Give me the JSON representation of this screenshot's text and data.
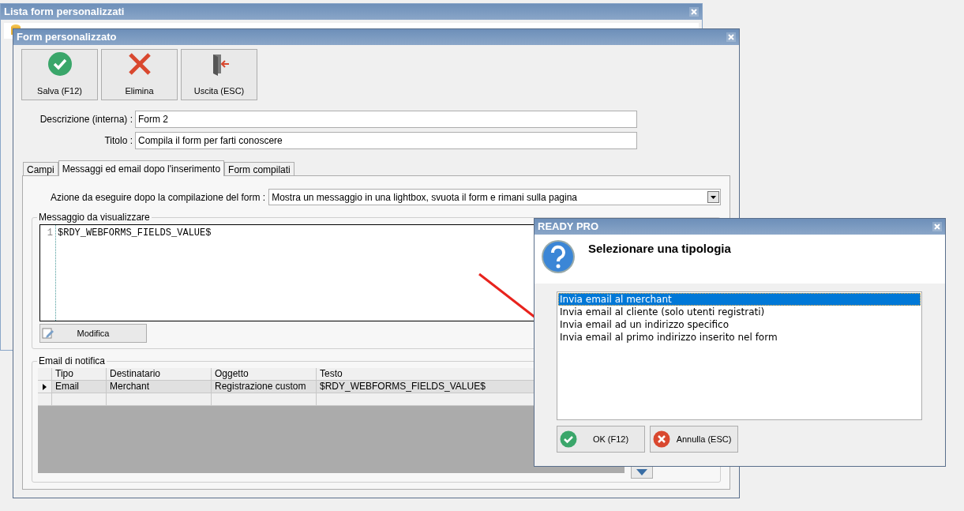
{
  "back_window": {
    "title": "Lista form personalizzati"
  },
  "window": {
    "title": "Form personalizzato",
    "toolbar": [
      {
        "kind": "save",
        "label": "Salva (F12)"
      },
      {
        "kind": "delete",
        "label": "Elimina"
      },
      {
        "kind": "exit",
        "label": "Uscita (ESC)"
      }
    ],
    "fields": [
      {
        "label": "Descrizione (interna) :",
        "value": "Form 2"
      },
      {
        "label": "Titolo :",
        "value": "Compila il form per farti conoscere"
      }
    ],
    "tabs": [
      {
        "label": "Campi",
        "selected": false
      },
      {
        "label": "Messaggi ed email dopo l'inserimento",
        "selected": true
      },
      {
        "label": "Form compilati",
        "selected": false
      }
    ],
    "action": {
      "label": "Azione da eseguire dopo la compilazione del form :",
      "value": "Mostra un messaggio in una lightbox, svuota il form e rimani sulla pagina"
    },
    "message_group": {
      "title": "Messaggio da visualizzare",
      "lines": [
        {
          "number": "1",
          "text": "$RDY_WEBFORMS_FIELDS_VALUE$"
        }
      ],
      "edit_button": "Modifica"
    },
    "email_group": {
      "title": "Email di notifica",
      "columns": [
        "Tipo",
        "Destinatario",
        "Oggetto",
        "Testo"
      ],
      "rows": [
        {
          "current": true,
          "cells": [
            "Email",
            "Merchant",
            "Registrazione custom",
            "$RDY_WEBFORMS_FIELDS_VALUE$"
          ]
        },
        {
          "current": false,
          "cells": []
        }
      ]
    }
  },
  "dialog": {
    "title": "READY PRO",
    "heading": "Selezionare una tipologia",
    "options": [
      {
        "label": "Invia email al merchant",
        "selected": true
      },
      {
        "label": "Invia email al cliente (solo utenti registrati)",
        "selected": false
      },
      {
        "label": "Invia email ad un indirizzo specifico",
        "selected": false
      },
      {
        "label": "Invia email al primo indirizzo inserito nel form",
        "selected": false
      }
    ],
    "buttons": [
      {
        "kind": "ok",
        "label": "OK (F12)"
      },
      {
        "kind": "cancel",
        "label": "Annulla (ESC)"
      }
    ]
  }
}
